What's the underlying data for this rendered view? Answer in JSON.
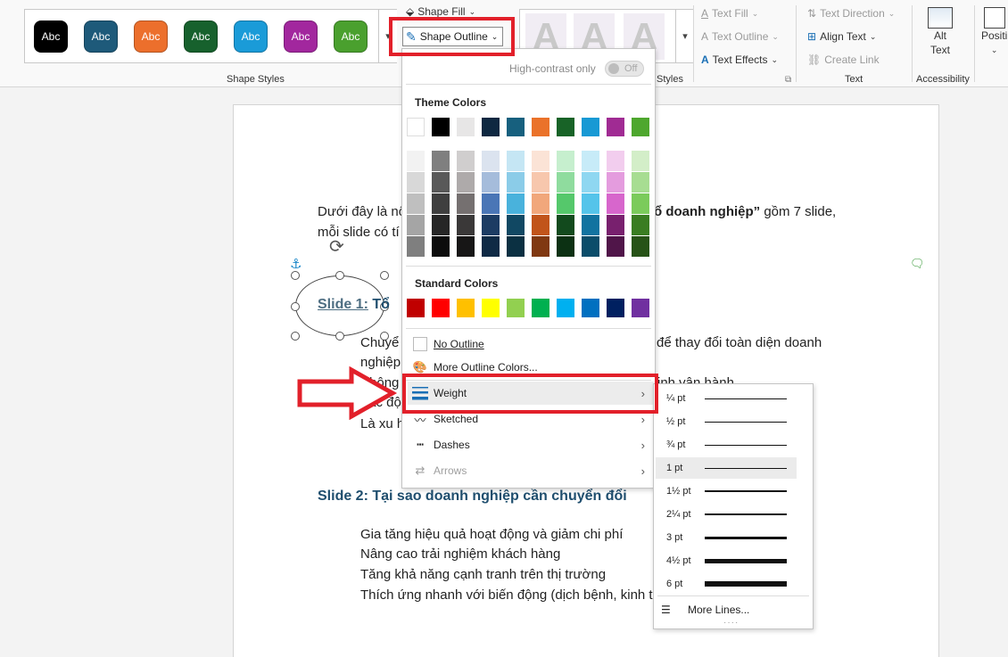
{
  "ribbon": {
    "shape_styles_label": "Shape Styles",
    "style_buttons": [
      {
        "label": "Abc",
        "color": "#000000"
      },
      {
        "label": "Abc",
        "color": "#1e5a7a"
      },
      {
        "label": "Abc",
        "color": "#ec6f2c"
      },
      {
        "label": "Abc",
        "color": "#17612d"
      },
      {
        "label": "Abc",
        "color": "#1a9bd8"
      },
      {
        "label": "Abc",
        "color": "#a2279e"
      },
      {
        "label": "Abc",
        "color": "#4aa02e"
      }
    ],
    "shape_fill": "Shape Fill",
    "shape_outline": "Shape Outline",
    "wordart_tile": "A",
    "wordart_group_label": "Styles",
    "text_fill": "Text Fill",
    "text_outline": "Text Outline",
    "text_effects": "Text Effects",
    "text_direction": "Text Direction",
    "align_text": "Align Text",
    "create_link": "Create Link",
    "text_group_label": "Text",
    "alt_text_1": "Alt",
    "alt_text_2": "Text",
    "accessibility_label": "Accessibility",
    "position": "Positi"
  },
  "document": {
    "line1a": "Dưới đây là nộ",
    "line1b": "ổ doanh nghiệp”",
    "line1c": " gồm 7 slide,",
    "line2": "mỗi slide có tí",
    "slide1_heading": "Slide 1:",
    "slide1_rest": " Tổ",
    "bullet1a": "Chuyể",
    "bullet1b": "để thay đổi toàn diện doanh",
    "bullet1c": "nghiệp",
    "bullet2a": "Không",
    "bullet2b": "inh vận hành",
    "bullet3": "Tác độ",
    "bullet4": "Là xu h",
    "slide2_heading": "Slide 2: Tại sao doanh nghiệp cần chuyển đổi",
    "s2_items": [
      "Gia tăng hiệu quả hoạt động và giảm chi phí",
      "Nâng cao trải nghiệm khách hàng",
      "Tăng khả năng cạnh tranh trên thị trường",
      "Thích ứng nhanh với biến động (dịch bệnh, kinh t"
    ]
  },
  "outline_menu": {
    "high_contrast_label": "High-contrast only",
    "toggle_state": "Off",
    "theme_colors_title": "Theme Colors",
    "theme_top": [
      "#ffffff",
      "#000000",
      "#e7e6e6",
      "#0e2841",
      "#17607e",
      "#ea722a",
      "#186327",
      "#1899d4",
      "#a02b93",
      "#4ea72e"
    ],
    "theme_shades": [
      [
        "#f2f2f2",
        "#7f7f7f",
        "#d0cece",
        "#dbe3ef",
        "#c5e6f4",
        "#fbe3d6",
        "#c6efce",
        "#c7ebf8",
        "#f2cdee",
        "#d3eec8"
      ],
      [
        "#d8d8d8",
        "#595959",
        "#aeaaaa",
        "#a5bcdb",
        "#8bcce8",
        "#f7c7ad",
        "#8fdc9e",
        "#8fd7f1",
        "#e49cde",
        "#a7dd92"
      ],
      [
        "#bfbfbf",
        "#3f3f3f",
        "#757070",
        "#4a76b6",
        "#49b2dc",
        "#f1a77b",
        "#55c86b",
        "#55c4ea",
        "#d766cc",
        "#7bcb5b"
      ],
      [
        "#a5a5a5",
        "#262626",
        "#3a3838",
        "#1c3c63",
        "#114863",
        "#c1541a",
        "#124a1d",
        "#1173a0",
        "#78206e",
        "#3a7d22"
      ],
      [
        "#7f7f7f",
        "#0c0c0c",
        "#171616",
        "#0f2a45",
        "#0b3042",
        "#803811",
        "#0c3113",
        "#0b4d6a",
        "#501549",
        "#275317"
      ]
    ],
    "standard_colors_title": "Standard Colors",
    "standard": [
      "#c00000",
      "#ff0000",
      "#ffc000",
      "#ffff00",
      "#92d050",
      "#00b050",
      "#00b0f0",
      "#0070c0",
      "#002060",
      "#7030a0"
    ],
    "no_outline": "No Outline",
    "more_colors": "More Outline Colors...",
    "weight": "Weight",
    "sketched": "Sketched",
    "dashes": "Dashes",
    "arrows": "Arrows"
  },
  "weight_menu": {
    "options": [
      {
        "label": "¼ pt",
        "pt": 0.25
      },
      {
        "label": "½ pt",
        "pt": 0.5
      },
      {
        "label": "¾ pt",
        "pt": 0.75
      },
      {
        "label": "1 pt",
        "pt": 1,
        "selected": true
      },
      {
        "label": "1½ pt",
        "pt": 1.5
      },
      {
        "label": "2¼ pt",
        "pt": 2.25
      },
      {
        "label": "3 pt",
        "pt": 3
      },
      {
        "label": "4½ pt",
        "pt": 4.5
      },
      {
        "label": "6 pt",
        "pt": 6
      }
    ],
    "more_lines": "More Lines..."
  },
  "colors": {
    "annotation_red": "#e2202a",
    "heading_blue": "#1f4e6e"
  }
}
